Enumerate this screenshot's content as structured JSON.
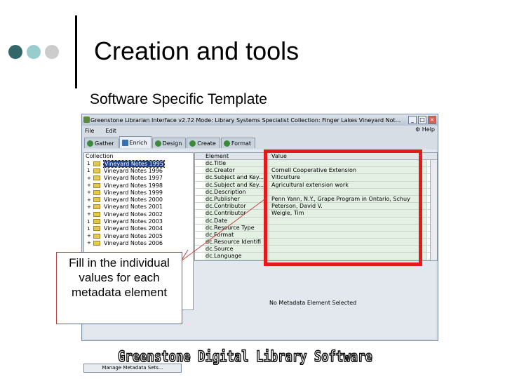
{
  "slide": {
    "title": "Creation and tools",
    "subtitle": "Software Specific Template",
    "dot_colors": [
      "#336666",
      "#99cccc",
      "#cccccc"
    ]
  },
  "window": {
    "title": "Greenstone Librarian Interface v2.72  Mode: Library Systems Specialist  Collection: Finger Lakes Vineyard Not...",
    "controls": [
      "_",
      "□",
      "×"
    ]
  },
  "menu": {
    "file": "File",
    "edit": "Edit",
    "help": "Help"
  },
  "tabs": [
    {
      "label": "Gather",
      "icon": "gather-icon"
    },
    {
      "label": "Enrich",
      "icon": "enrich-icon",
      "active": true
    },
    {
      "label": "Design",
      "icon": "design-icon"
    },
    {
      "label": "Create",
      "icon": "create-icon"
    },
    {
      "label": "Format",
      "icon": "format-icon"
    }
  ],
  "collection": {
    "header": "Collection",
    "items": [
      {
        "exp": "1",
        "label": "Vineyard Notes 1995",
        "selected": true
      },
      {
        "exp": "1",
        "label": "Vineyard Notes 1996"
      },
      {
        "exp": "+",
        "label": "Vineyard Notes 1997"
      },
      {
        "exp": "+",
        "label": "Vineyard Notes 1998"
      },
      {
        "exp": "+",
        "label": "Vineyard Notes 1999"
      },
      {
        "exp": "+",
        "label": "Vineyard Notes 2000"
      },
      {
        "exp": "+",
        "label": "Vineyard Notes 2001"
      },
      {
        "exp": "+",
        "label": "Vineyard Notes 2002"
      },
      {
        "exp": "1",
        "label": "Vineyard Notes 2003"
      },
      {
        "exp": "1",
        "label": "Vineyard Notes 2004"
      },
      {
        "exp": "+",
        "label": "Vineyard Notes 2005"
      },
      {
        "exp": "+",
        "label": "Vineyard Notes 2006"
      }
    ],
    "manage_button": "Manage Metadata Sets..."
  },
  "metadata": {
    "col_element": "Element",
    "col_value": "Value",
    "rows": [
      {
        "element": "dc.Title",
        "value": ""
      },
      {
        "element": "dc.Creator",
        "value": "Cornell Cooperative Extension"
      },
      {
        "element": "dc.Subject and Key...",
        "value": "Viticulture"
      },
      {
        "element": "dc.Subject and Key...",
        "value": "Agricultural extension work"
      },
      {
        "element": "dc.Description",
        "value": ""
      },
      {
        "element": "dc.Publisher",
        "value": "Penn Yann, N.Y., Grape Program in Ontario, Schuy"
      },
      {
        "element": "dc.Contributor",
        "value": "Peterson, David V."
      },
      {
        "element": "dc.Contributor",
        "value": "Weigle, Tim"
      },
      {
        "element": "dc.Date",
        "value": ""
      },
      {
        "element": "dc.Resource Type",
        "value": ""
      },
      {
        "element": "dc.Format",
        "value": ""
      },
      {
        "element": "dc.Resource Identifi",
        "value": ""
      },
      {
        "element": "dc.Source",
        "value": ""
      },
      {
        "element": "dc.Language",
        "value": ""
      }
    ],
    "no_selection": "No Metadata Element Selected"
  },
  "callout": {
    "text": "Fill in the individual values for each metadata element"
  },
  "footer": {
    "text": "Greenstone Digital Library Software"
  }
}
